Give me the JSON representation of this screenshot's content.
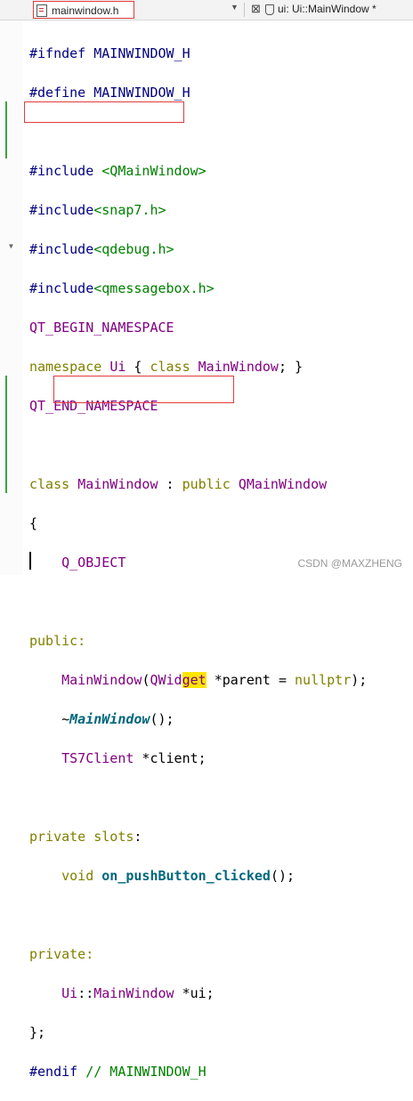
{
  "tabs": {
    "active_file": "mainwindow.h",
    "context": "ui: Ui::MainWindow *"
  },
  "code": {
    "l1": [
      "#ifndef MAINWINDOW_H"
    ],
    "l2": [
      "#define MAINWINDOW_H"
    ],
    "l4a": "#include",
    "l4b": "<QMainWindow>",
    "l5a": "#include",
    "l5b": "<snap7.h>",
    "l6a": "#include",
    "l6b": "<qdebug.h>",
    "l7a": "#include",
    "l7b": "<qmessagebox.h>",
    "l8": "QT_BEGIN_NAMESPACE",
    "l9a": "namespace",
    "l9b": "Ui",
    "l9c": "{",
    "l9d": "class",
    "l9e": "MainWindow",
    "l9f": "; }",
    "l10": "QT_END_NAMESPACE",
    "l12a": "class",
    "l12b": "MainWindow",
    "l12c": ":",
    "l12d": "public",
    "l12e": "QMainWindow",
    "l13": "{",
    "l14": "Q_OBJECT",
    "l16": "public:",
    "l17a": "MainWindow",
    "l17b": "(",
    "l17c": "QWid",
    "l17d": "get",
    "l17e": " *parent = ",
    "l17f": "nullptr",
    "l17g": ");",
    "l18a": "~",
    "l18b": "MainWindow",
    "l18c": "();",
    "l19a": "TS7Client",
    "l19b": " *client;",
    "l21a": "private slots",
    "l21b": ":",
    "l22a": "void",
    "l22b": "on_pushButton_clicked",
    "l22c": "();",
    "l24": "private:",
    "l25a": "Ui",
    "l25b": "::",
    "l25c": "MainWindow",
    "l25d": " *ui;",
    "l26": "};",
    "l27a": "#endif",
    "l27b": "// MAINWINDOW_H"
  },
  "watermark": "CSDN @MAXZHENG"
}
